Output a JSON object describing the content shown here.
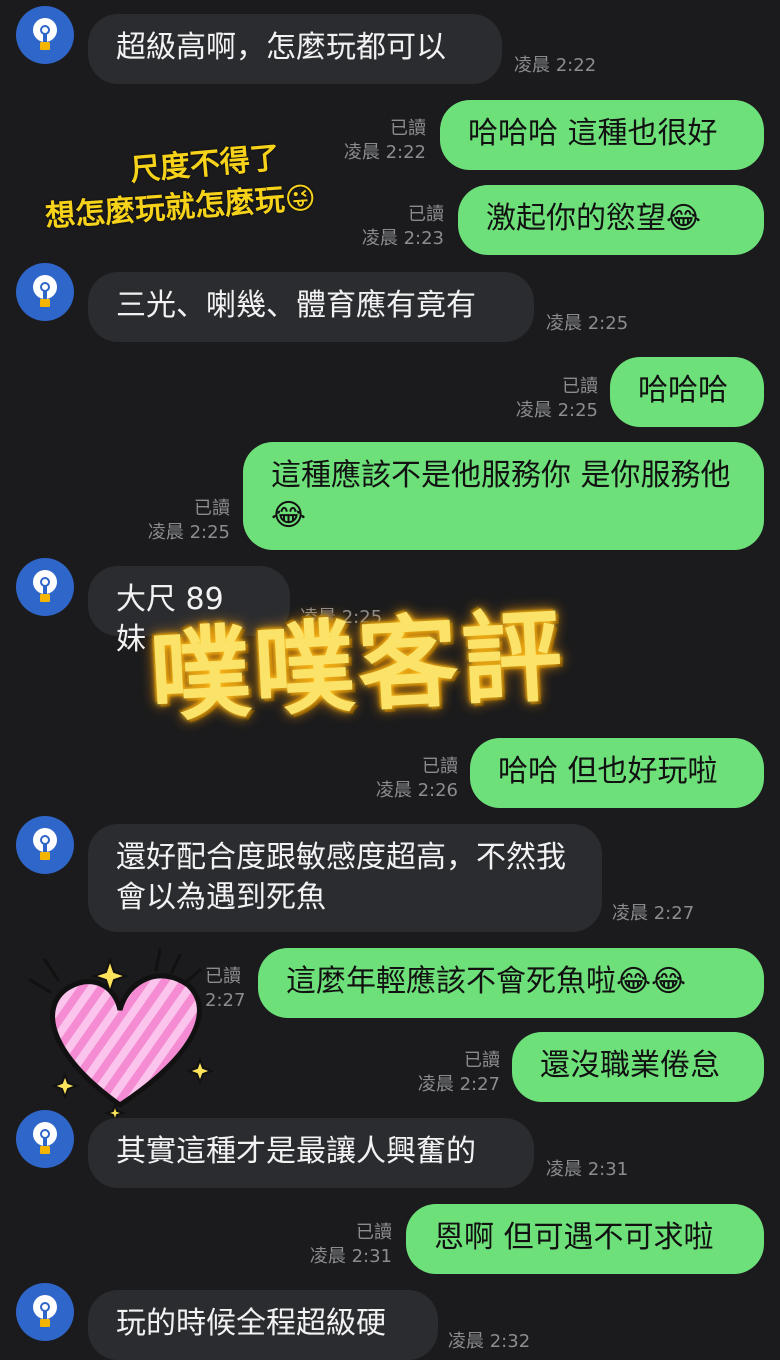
{
  "messages": [
    {
      "text": "超級高啊，怎麼玩都可以",
      "time": "凌晨 2:22"
    },
    {
      "text": "哈哈哈 這種也很好",
      "read": "已讀",
      "time": "凌晨 2:22"
    },
    {
      "text": "激起你的慾望😂",
      "read": "已讀",
      "time": "凌晨 2:23"
    },
    {
      "text": "三光、喇幾、體育應有竟有",
      "time": "凌晨 2:25"
    },
    {
      "text": "哈哈哈",
      "read": "已讀",
      "time": "凌晨 2:25"
    },
    {
      "text": "這種應該不是他服務你 是你服務他😂",
      "read": "已讀",
      "time": "凌晨 2:25"
    },
    {
      "text": "大尺 89 妹",
      "time": "凌晨 2:25"
    },
    {
      "text": "哈哈 但也好玩啦",
      "read": "已讀",
      "time": "凌晨 2:26"
    },
    {
      "text": "還好配合度跟敏感度超高，不然我會以為遇到死魚",
      "time": "凌晨 2:27"
    },
    {
      "text": "這麼年輕應該不會死魚啦😂😂",
      "read": "已讀",
      "time": "2:27"
    },
    {
      "text": "還沒職業倦怠",
      "read": "已讀",
      "time": "凌晨 2:27"
    },
    {
      "text": "其實這種才是最讓人興奮的",
      "time": "凌晨 2:31"
    },
    {
      "text": "恩啊 但可遇不可求啦",
      "read": "已讀",
      "time": "凌晨 2:31"
    },
    {
      "text": "玩的時候全程超級硬",
      "time": "凌晨 2:32"
    }
  ],
  "overlay": {
    "caption_line1": "尺度不得了",
    "caption_line2": "想怎麼玩就怎麼玩",
    "caption_emoji": "😜",
    "sticker_text": "噗噗客評"
  },
  "colors": {
    "incoming": "#2b2c30",
    "outgoing": "#6ee07a",
    "background": "#1b1b1d",
    "avatar": "#2f66c9",
    "sticker": "#fbe36a"
  },
  "icons": [
    "lightbulb-avatar-icon",
    "heart-sticker-icon",
    "sparkle-icon"
  ]
}
